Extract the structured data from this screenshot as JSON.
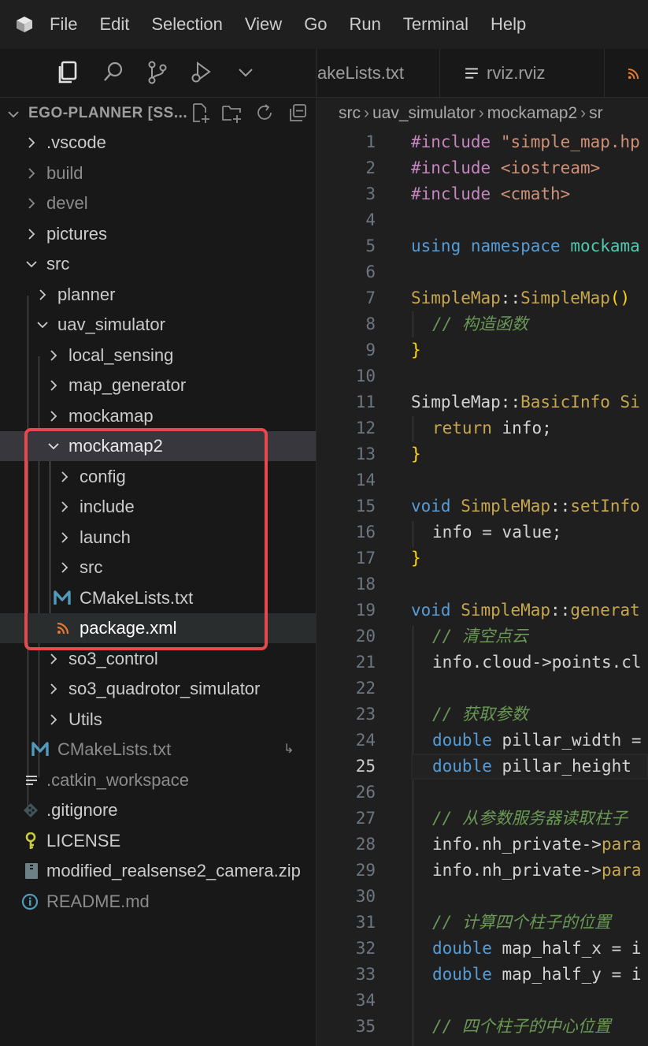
{
  "menu": [
    "File",
    "Edit",
    "Selection",
    "View",
    "Go",
    "Run",
    "Terminal",
    "Help"
  ],
  "explorer": {
    "title": "EGO-PLANNER [SS...",
    "tree": [
      {
        "label": ".vscode",
        "expanded": false
      },
      {
        "label": "build",
        "expanded": false
      },
      {
        "label": "devel",
        "expanded": false
      },
      {
        "label": "pictures",
        "expanded": false
      },
      {
        "label": "src",
        "expanded": true
      },
      {
        "label": "planner",
        "expanded": false
      },
      {
        "label": "uav_simulator",
        "expanded": true
      },
      {
        "label": "local_sensing",
        "expanded": false
      },
      {
        "label": "map_generator",
        "expanded": false
      },
      {
        "label": "mockamap",
        "expanded": false
      },
      {
        "label": "mockamap2",
        "expanded": true
      },
      {
        "label": "config",
        "expanded": false
      },
      {
        "label": "include",
        "expanded": false
      },
      {
        "label": "launch",
        "expanded": false
      },
      {
        "label": "src",
        "expanded": false
      },
      {
        "label": "CMakeLists.txt",
        "icon": "cmake-icon"
      },
      {
        "label": "package.xml",
        "icon": "rss-icon"
      },
      {
        "label": "so3_control",
        "expanded": false
      },
      {
        "label": "so3_quadrotor_simulator",
        "expanded": false
      },
      {
        "label": "Utils",
        "expanded": false
      },
      {
        "label": "CMakeLists.txt",
        "icon": "cmake-icon"
      },
      {
        "label": ".catkin_workspace",
        "icon": "lines-icon"
      },
      {
        "label": ".gitignore",
        "icon": "git-icon"
      },
      {
        "label": "LICENSE",
        "icon": "key-icon"
      },
      {
        "label": "modified_realsense2_camera.zip",
        "icon": "zip-icon"
      },
      {
        "label": "README.md",
        "icon": "info-icon"
      }
    ],
    "symlink_glyph": "↳"
  },
  "tabs": [
    {
      "label": "akeLists.txt"
    },
    {
      "label": "rviz.rviz"
    }
  ],
  "breadcrumb": [
    "src",
    "uav_simulator",
    "mockamap2",
    "sr"
  ],
  "editor": {
    "active_line": "25",
    "lines": [
      "1",
      "2",
      "3",
      "4",
      "5",
      "6",
      "7",
      "8",
      "9",
      "10",
      "11",
      "12",
      "13",
      "14",
      "15",
      "16",
      "17",
      "18",
      "19",
      "20",
      "21",
      "22",
      "23",
      "24",
      "25",
      "26",
      "27",
      "28",
      "29",
      "30",
      "31",
      "32",
      "33",
      "34",
      "35"
    ],
    "code": {
      "l1_kw": "#include",
      "l1_str": "\"simple_map.hp",
      "l2_kw": "#include",
      "l2_str": "<iostream>",
      "l3_kw": "#include",
      "l3_str": "<cmath>",
      "l5_a": "using",
      "l5_b": "namespace",
      "l5_c": "mockama",
      "l7_a": "SimpleMap",
      "l7_b": "::",
      "l7_c": "SimpleMap",
      "l7_d": "()",
      "l8": "// 构造函数",
      "l9": "}",
      "l11_a": "SimpleMap",
      "l11_b": "::",
      "l11_c": "BasicInfo",
      "l11_d": "Si",
      "l12_a": "return",
      "l12_b": "info;",
      "l13": "}",
      "l15_a": "void",
      "l15_b": "SimpleMap",
      "l15_c": "::",
      "l15_d": "setInfo",
      "l16_a": "info",
      "l16_b": "=",
      "l16_c": "value;",
      "l17": "}",
      "l19_a": "void",
      "l19_b": "SimpleMap",
      "l19_c": "::",
      "l19_d": "generat",
      "l20": "// 清空点云",
      "l21_a": "info",
      "l21_b": ".cloud->points.cl",
      "l23": "// 获取参数",
      "l24_a": "double",
      "l24_b": "pillar_width =",
      "l25_a": "double",
      "l25_b": "pillar_height",
      "l27": "// 从参数服务器读取柱子",
      "l28_a": "info",
      "l28_b": ".nh_private->",
      "l28_c": "para",
      "l29_a": "info",
      "l29_b": ".nh_private->",
      "l29_c": "para",
      "l31": "// 计算四个柱子的位置",
      "l32_a": "double",
      "l32_b": "map_half_x = i",
      "l33_a": "double",
      "l33_b": "map_half_y = i",
      "l35": "// 四个柱子的中心位置"
    }
  }
}
